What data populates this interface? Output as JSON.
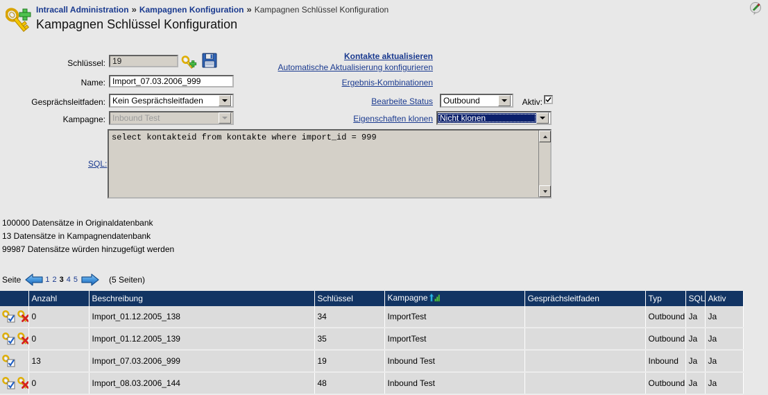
{
  "breadcrumb": {
    "items": [
      "Intracall Administration",
      "Kampagnen Konfiguration",
      "Kampagnen Schlüssel Konfiguration"
    ],
    "separator": "»"
  },
  "page_title": "Kampagnen Schlüssel Konfiguration",
  "form": {
    "schluessel": {
      "label": "Schlüssel:",
      "value": "19"
    },
    "name": {
      "label": "Name:",
      "value": "Import_07.03.2006_999"
    },
    "gespraechsleitfaden": {
      "label": "Gesprächsleitfaden:",
      "value": "Kein Gesprächsleitfaden"
    },
    "kampagne": {
      "label": "Kampagne:",
      "value": "Inbound Test"
    },
    "sql": {
      "label": "SQL:",
      "value": "select kontakteid from kontakte where import_id = 999"
    },
    "add_key_icon": "key-add-icon",
    "save_icon": "floppy-save-icon"
  },
  "links": {
    "kontakte_aktualisieren": "Kontakte aktualisieren",
    "automatische_aktualisierung": "Automatische Aktualisierung konfigurieren",
    "ergebnis_kombinationen": "Ergebnis-Kombinationen",
    "bearbeite_status": "Bearbeite Status",
    "eigenschaften_klonen": "Eigenschaften klonen"
  },
  "controls": {
    "status_select": {
      "value": "Outbound"
    },
    "aktiv": {
      "label": "Aktiv:",
      "checked": true
    },
    "klonen_select": {
      "value": "Nicht klonen"
    }
  },
  "counts": [
    "100000 Datensätze in Originaldatenbank",
    "13 Datensätze in Kampagnendatenbank",
    "99987 Datensätze würden hinzugefügt werden"
  ],
  "pager": {
    "label": "Seite",
    "prev_icon": "arrow-left-icon",
    "next_icon": "arrow-right-icon",
    "pages": [
      "1",
      "2",
      "3",
      "4",
      "5"
    ],
    "current": "3",
    "total_text": "(5  Seiten)"
  },
  "table": {
    "columns": [
      "",
      "Anzahl",
      "Beschreibung",
      "Schlüssel",
      "Kampagne",
      "Gesprächsleitfaden",
      "Typ",
      "SQL",
      "Aktiv"
    ],
    "sorted_column": "Kampagne",
    "sort_icon": "sort-ascending-icon",
    "rows": [
      {
        "edit_icon": "key-edit-icon",
        "delete_icon": "key-delete-icon",
        "anzahl": "0",
        "beschreibung": "Import_01.12.2005_138",
        "schluessel": "34",
        "kampagne": "ImportTest",
        "gespraechsleitfaden": "",
        "typ": "Outbound",
        "sql": "Ja",
        "aktiv": "Ja"
      },
      {
        "edit_icon": "key-edit-icon",
        "delete_icon": "key-delete-icon",
        "anzahl": "0",
        "beschreibung": "Import_01.12.2005_139",
        "schluessel": "35",
        "kampagne": "ImportTest",
        "gespraechsleitfaden": "",
        "typ": "Outbound",
        "sql": "Ja",
        "aktiv": "Ja"
      },
      {
        "edit_icon": "key-edit-icon",
        "delete_icon": "",
        "anzahl": "13",
        "beschreibung": "Import_07.03.2006_999",
        "schluessel": "19",
        "kampagne": "Inbound Test",
        "gespraechsleitfaden": "",
        "typ": "Inbound",
        "sql": "Ja",
        "aktiv": "Ja"
      },
      {
        "edit_icon": "key-edit-icon",
        "delete_icon": "key-delete-icon",
        "anzahl": "0",
        "beschreibung": "Import_08.03.2006_144",
        "schluessel": "48",
        "kampagne": "Inbound Test",
        "gespraechsleitfaden": "",
        "typ": "Outbound",
        "sql": "Ja",
        "aktiv": "Ja"
      }
    ]
  },
  "colors": {
    "header_bg": "#123463",
    "link": "#1a3a8f",
    "row_bg": "#dcdcdc",
    "page_bg": "#e8e8e8"
  }
}
